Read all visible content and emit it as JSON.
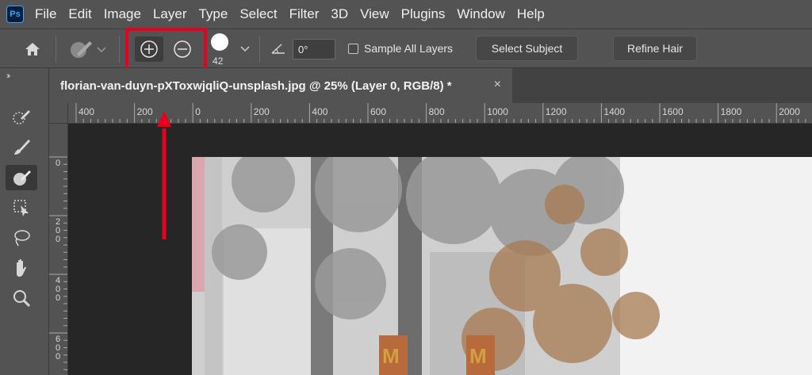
{
  "app": {
    "logo_text": "Ps",
    "accent": "#31a8ff"
  },
  "menu": [
    "File",
    "Edit",
    "Image",
    "Layer",
    "Type",
    "Select",
    "Filter",
    "3D",
    "View",
    "Plugins",
    "Window",
    "Help"
  ],
  "options": {
    "brush_size": "42",
    "angle_value": "0°",
    "sample_all_layers_label": "Sample All Layers",
    "sample_all_layers_checked": false,
    "select_subject_label": "Select Subject",
    "refine_hair_label": "Refine Hair"
  },
  "document": {
    "tab_title": "florian-van-duyn-pXToxwjqliQ-unsplash.jpg @ 25% (Layer 0, RGB/8) *",
    "close_glyph": "×"
  },
  "ruler": {
    "horizontal_labels": [
      "400",
      "200",
      "0",
      "200",
      "400",
      "600",
      "800",
      "1000",
      "1200",
      "1400",
      "1600",
      "1800",
      "2000"
    ],
    "vertical_labels": [
      "0",
      "200",
      "400",
      "600"
    ]
  },
  "annotation": {
    "highlight_color": "#e8001c"
  },
  "tools": [
    "quick-selection-tool",
    "brush-tool",
    "select-and-mask-brush-tool",
    "object-selection-tool",
    "lasso-tool",
    "hand-tool",
    "zoom-tool"
  ],
  "icons": [
    "home-icon",
    "brush-preset-icon",
    "add-to-selection-icon",
    "subtract-from-selection-icon",
    "brush-tip-icon",
    "angle-icon",
    "chevron-down-icon",
    "close-icon"
  ]
}
